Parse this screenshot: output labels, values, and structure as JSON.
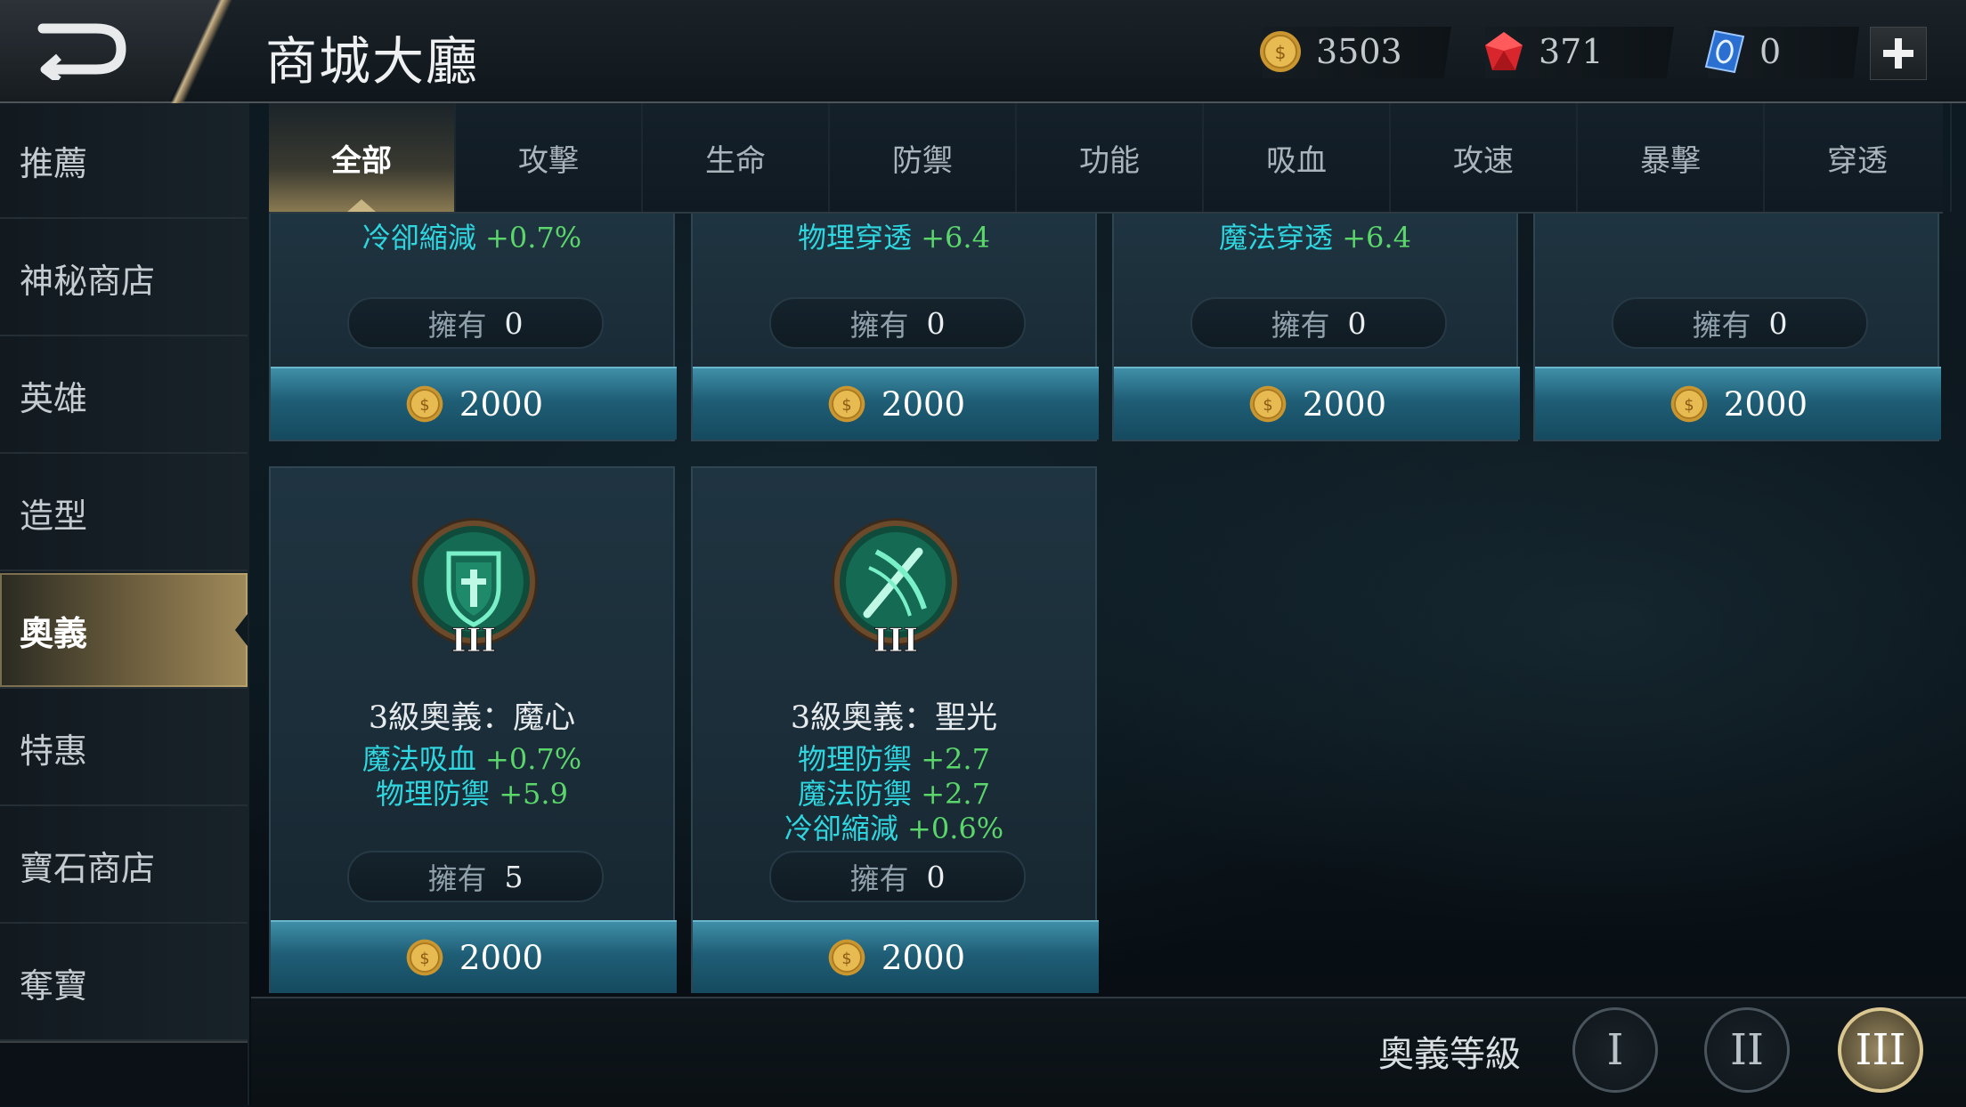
{
  "header": {
    "title": "商城大廳",
    "gold": "3503",
    "gems": "371",
    "vouchers": "0"
  },
  "sidebar": {
    "items": [
      {
        "label": "推薦"
      },
      {
        "label": "神秘商店"
      },
      {
        "label": "英雄"
      },
      {
        "label": "造型"
      },
      {
        "label": "奧義",
        "active": true
      },
      {
        "label": "特惠"
      },
      {
        "label": "寶石商店"
      },
      {
        "label": "奪寶"
      }
    ]
  },
  "tabs": [
    {
      "label": "全部",
      "active": true
    },
    {
      "label": "攻擊"
    },
    {
      "label": "生命"
    },
    {
      "label": "防禦"
    },
    {
      "label": "功能"
    },
    {
      "label": "吸血"
    },
    {
      "label": "攻速"
    },
    {
      "label": "暴擊"
    },
    {
      "label": "穿透"
    }
  ],
  "top_cards": [
    {
      "stat_name": "冷卻縮減",
      "stat_value": "+0.7%",
      "own_label": "擁有",
      "own_count": "0",
      "price": "2000"
    },
    {
      "stat_name": "物理穿透",
      "stat_value": "+6.4",
      "own_label": "擁有",
      "own_count": "0",
      "price": "2000"
    },
    {
      "stat_name": "魔法穿透",
      "stat_value": "+6.4",
      "own_label": "擁有",
      "own_count": "0",
      "price": "2000"
    },
    {
      "stat_name": "",
      "stat_value": "",
      "own_label": "擁有",
      "own_count": "0",
      "price": "2000"
    }
  ],
  "cards": [
    {
      "name": "3級奧義：魔心",
      "rank": "III",
      "icon": "shield-sword-emblem-icon",
      "stats": [
        {
          "name": "魔法吸血",
          "value": "+0.7%"
        },
        {
          "name": "物理防禦",
          "value": "+5.9"
        }
      ],
      "own_label": "擁有",
      "own_count": "5",
      "price": "2000"
    },
    {
      "name": "3級奧義：聖光",
      "rank": "III",
      "icon": "crossed-blades-emblem-icon",
      "stats": [
        {
          "name": "物理防禦",
          "value": "+2.7"
        },
        {
          "name": "魔法防禦",
          "value": "+2.7"
        },
        {
          "name": "冷卻縮減",
          "value": "+0.6%"
        }
      ],
      "own_label": "擁有",
      "own_count": "0",
      "price": "2000"
    }
  ],
  "bottom": {
    "level_label": "奧義等級",
    "levels": [
      "I",
      "II",
      "III"
    ],
    "active_level": "III"
  },
  "colors": {
    "stat_name": "#2fd6df",
    "stat_value": "#5bd66a",
    "accent_gold": "#d9c690",
    "buy_button": "#1f5e76"
  }
}
